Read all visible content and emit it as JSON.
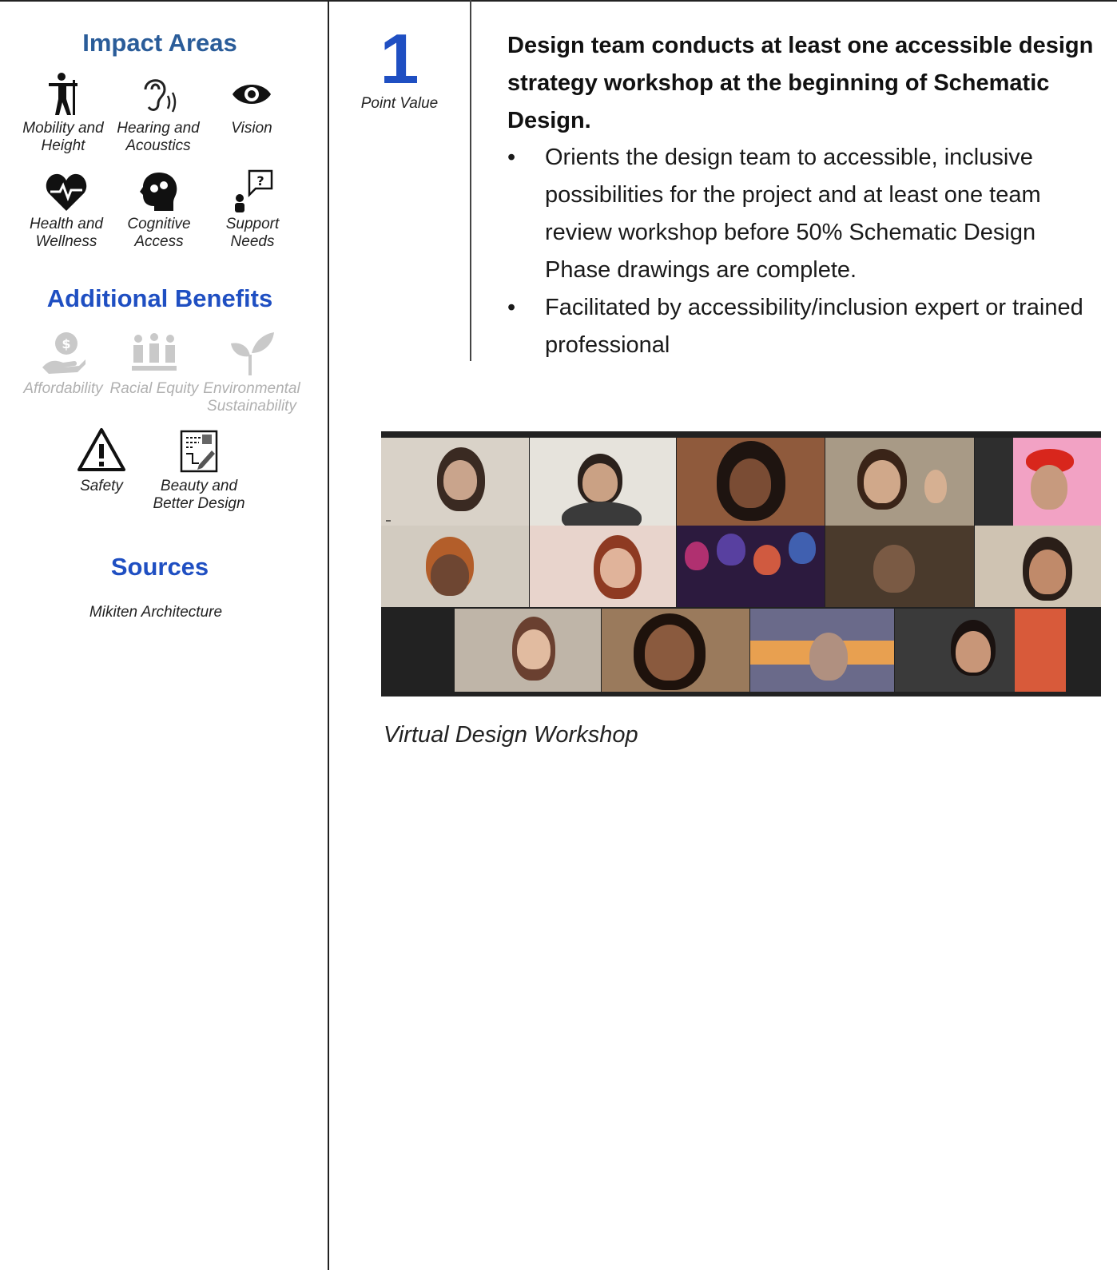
{
  "sidebar": {
    "impact_title": "Impact Areas",
    "impact_items": [
      {
        "label": "Mobility and Height",
        "icon": "mobility-icon"
      },
      {
        "label": "Hearing and Acoustics",
        "icon": "ear-icon"
      },
      {
        "label": "Vision",
        "icon": "eye-icon"
      },
      {
        "label": "Health and Wellness",
        "icon": "heart-icon"
      },
      {
        "label": "Cognitive Access",
        "icon": "brain-head-icon"
      },
      {
        "label": "Support Needs",
        "icon": "question-bubble-icon"
      }
    ],
    "benefits_title": "Additional Benefits",
    "benefit_items": [
      {
        "label": "Affordability",
        "icon": "money-hand-icon",
        "active": false
      },
      {
        "label": "Racial Equity",
        "icon": "people-icon",
        "active": false
      },
      {
        "label": "Environmental Sustainability",
        "icon": "plant-icon",
        "active": false
      },
      {
        "label": "Safety",
        "icon": "warning-icon",
        "active": true
      },
      {
        "label": "Beauty and Better Design",
        "icon": "design-sketch-icon",
        "active": true
      }
    ],
    "sources_title": "Sources",
    "sources_text": "Mikiten Architecture"
  },
  "point": {
    "value": "1",
    "label": "Point Value"
  },
  "main": {
    "headline": "Design team conducts at least one accessible design strategy workshop at the beginning of Schematic Design.",
    "bullets": [
      "Orients the design team to accessible, inclusive possibilities for the project and at least one team review workshop before 50% Schematic Design Phase drawings are complete.",
      "Facilitated by accessibility/inclusion expert or trained professional"
    ],
    "photo_caption": "Virtual Design Workshop"
  },
  "colors": {
    "accent_blue": "#1f4fc2",
    "impact_blue": "#2a5c99",
    "faded_gray": "#b0b0b0"
  }
}
